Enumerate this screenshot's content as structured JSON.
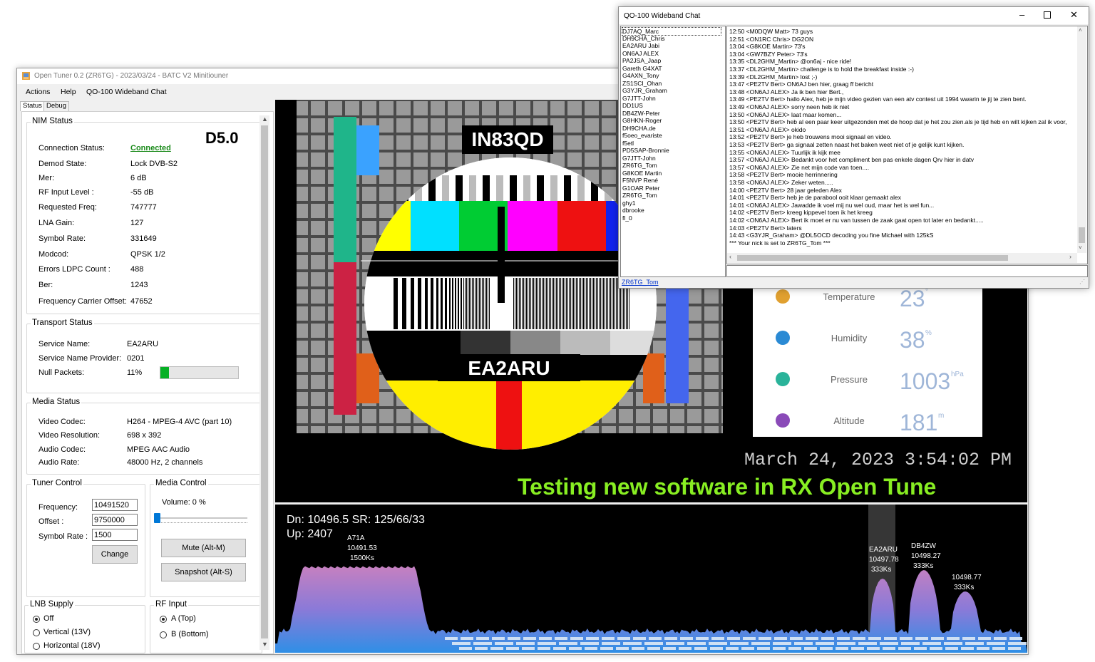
{
  "main_window": {
    "title": "Open Tuner 0.2 (ZR6TG) - 2023/03/24 - BATC V2 Minitiouner",
    "menu": [
      "Actions",
      "Help",
      "QO-100 Wideband Chat"
    ],
    "tabs": [
      "Status",
      "Debug"
    ]
  },
  "nim_status": {
    "title": "NIM Status",
    "badge": "D5.0",
    "rows": [
      {
        "label": "Connection Status:",
        "value": "Connected"
      },
      {
        "label": "Demod State:",
        "value": "Lock DVB-S2"
      },
      {
        "label": "Mer:",
        "value": "6 dB"
      },
      {
        "label": "RF Input Level :",
        "value": "-55 dB"
      },
      {
        "label": "Requested Freq:",
        "value": "747777"
      },
      {
        "label": "LNA Gain:",
        "value": "127"
      },
      {
        "label": "Symbol Rate:",
        "value": "331649"
      },
      {
        "label": "Modcod:",
        "value": "QPSK 1/2"
      },
      {
        "label": "Errors LDPC Count :",
        "value": "488"
      },
      {
        "label": "Ber:",
        "value": "1243"
      },
      {
        "label": "Frequency Carrier Offset:",
        "value": "47652"
      }
    ],
    "connected_color": "#1a8a1a"
  },
  "transport_status": {
    "title": "Transport Status",
    "rows": [
      {
        "label": "Service Name:",
        "value": "EA2ARU"
      },
      {
        "label": "Service Name Provider:",
        "value": "0201"
      },
      {
        "label": "Null Packets:",
        "value": "11%"
      }
    ],
    "null_packets_fraction": 0.11
  },
  "media_status": {
    "title": "Media Status",
    "rows": [
      {
        "label": "Video Codec:",
        "value": "H264 - MPEG-4 AVC (part 10)"
      },
      {
        "label": "Video Resolution:",
        "value": "698 x 392"
      },
      {
        "label": "Audio Codec:",
        "value": "MPEG AAC Audio"
      },
      {
        "label": "Audio Rate:",
        "value": "48000 Hz, 2 channels"
      }
    ]
  },
  "tuner_control": {
    "title": "Tuner Control",
    "frequency_label": "Frequency:",
    "frequency": "10491520",
    "offset_label": "Offset :",
    "offset": "9750000",
    "symbol_rate_label": "Symbol Rate :",
    "symbol_rate": "1500",
    "change_button": "Change"
  },
  "media_control": {
    "title": "Media Control",
    "volume_label": "Volume: 0 %",
    "volume_fraction": 0,
    "mute_button": "Mute (Alt-M)",
    "snapshot_button": "Snapshot (Alt-S)"
  },
  "lnb_supply": {
    "title": "LNB Supply",
    "options": [
      "Off",
      "Vertical (13V)",
      "Horizontal (18V)"
    ],
    "selected": "Off"
  },
  "rf_input": {
    "title": "RF Input",
    "options": [
      "A (Top)",
      "B (Bottom)"
    ],
    "selected": "A (Top)"
  },
  "video": {
    "callsign_top": "IN83QD",
    "callsign_bottom": "EA2ARU",
    "weather": [
      {
        "label": "Temperature",
        "value": "23",
        "unit": "°",
        "icon": "thermometer-icon"
      },
      {
        "label": "Humidity",
        "value": "38",
        "unit": "%",
        "icon": "water-drop-icon"
      },
      {
        "label": "Pressure",
        "value": "1003",
        "unit": "hPa",
        "icon": "gauge-icon"
      },
      {
        "label": "Altitude",
        "value": "181",
        "unit": "m",
        "icon": "mountain-icon"
      }
    ],
    "datetime": "March 24, 2023 3:54:02 PM",
    "ticker": "Testing new software in RX Open Tune"
  },
  "spectrum": {
    "dn_line": "Dn: 10496.5  SR: 125/66/33",
    "up_line": "Up: 2407",
    "signals": [
      {
        "name": "A71A",
        "freq": "10491.53",
        "sr": "1500Ks"
      },
      {
        "name": "EA2ARU",
        "freq": "10497.78",
        "sr": "333Ks"
      },
      {
        "name": "DB4ZW",
        "freq": "10498.27",
        "sr": "333Ks"
      },
      {
        "name": "",
        "freq": "10498.77",
        "sr": "333Ks"
      }
    ]
  },
  "chat_window": {
    "title": "QO-100 Wideband Chat",
    "nicks": [
      "DJ7AQ_Marc",
      "DH9CHA_Chris",
      "EA2ARU Jabi",
      "ON6AJ ALEX",
      "PA2JSA_Jaap",
      "Gareth G4XAT",
      "G4AXN_Tony",
      "ZS1SCI_Ohan",
      "G3YJR_Graham",
      "G7JTT-John",
      "DD1US",
      "DB4ZW-Peter",
      "G8HKN-Roger",
      "DH9CHA.de",
      "f5oeo_evariste",
      "f5etl",
      "PD5SAP-Bronnie",
      "G7JTT-John",
      "ZR6TG_Tom",
      "G8KOE Martin",
      "F5NVP René",
      "G1OAR Peter",
      "ZR6TG_Tom",
      "ghy1",
      "dbrooke",
      "fl_0"
    ],
    "own_nick": "ZR6TG_Tom",
    "messages": [
      "12:50 <M0DQW Matt> 73 guys",
      "12:51 <ON1RC Chris>     DG2ON",
      "13:04 <G8KOE Martin> 73's",
      "13:04 <GW7BZY Peter> 73's",
      "13:35 <DL2GHM_Martin> @on6aj - nice ride!",
      "13:37 <DL2GHM_Martin> challenge is to hold the breakfast inside :-)",
      "13:39 <DL2GHM_Martin> lost ;-)",
      "13:47 <PE2TV Bert> ON6AJ ben hier, graag ff bericht",
      "13:48 <ON6AJ ALEX> Ja ik ben hier Bert.,",
      "13:49 <PE2TV Bert> hallo Alex, heb je mijn video gezien van een atv contest uit 1994 wwarin te jij te zien bent.",
      "13:49 <ON6AJ ALEX> sorry neen heb ik niet",
      "13:50 <ON6AJ ALEX> laat maar komen...",
      "13:50 <PE2TV Bert> heb al een paar keer uitgezonden met de hoop dat je het zou zien.als je tijd heb en wilt kijken zal ik voor,",
      "13:51 <ON6AJ ALEX> okido",
      "13:52 <PE2TV Bert> je heb trouwens mooi signaal en video.",
      "13:53 <PE2TV Bert> ga signaal zetten naast het baken weet niet of je gelijk kunt kijken.",
      "13:55 <ON6AJ ALEX> Tuurlijk ik kijk mee",
      "13:57 <ON6AJ ALEX> Bedankt voor het compliment ben pas enkele dagen Qrv hier in datv",
      "13:57 <ON6AJ ALEX> Zie net mijn code van toen....",
      "13:58 <PE2TV Bert> mooie herrinnering",
      "13:58 <ON6AJ ALEX> Zeker weten.....",
      "14:00 <PE2TV Bert> 28 jaar geleden Alex",
      "14:01 <PE2TV Bert> heb je de parabool ooit klaar gemaakt alex",
      "14:01 <ON6AJ ALEX> Jawadde ik voel mij nu wel oud, maar het is wel fun...",
      "14:02 <PE2TV Bert> kreeg kippevel toen ik het kreeg",
      "14:02 <ON6AJ ALEX> Bert ik moet er nu van tussen de zaak gaat open tot later en bedankt.....",
      "14:03 <PE2TV Bert> laters",
      "14:43 <G3YJR_Graham> @DL5OCD decoding you fine Michael with 125kS",
      "*** Your nick is set to ZR6TG_Tom ***"
    ]
  }
}
